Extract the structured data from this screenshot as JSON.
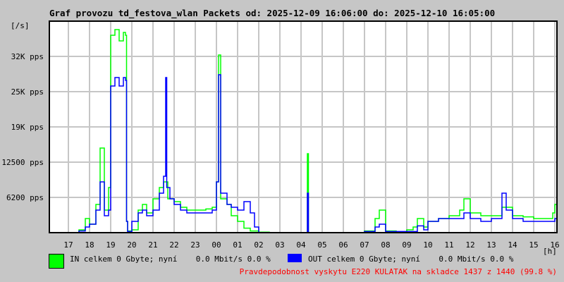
{
  "chart_data": {
    "type": "line",
    "title": "Graf provozu td_festova_wlan Packets od: 2025-12-09 16:06:00 do: 2025-12-10 16:05:00",
    "ylabel": "[/s]",
    "xlabel": "[h]",
    "xlim": [
      16.1,
      40.1
    ],
    "ylim": [
      0,
      37500
    ],
    "grid": true,
    "x_ticks": [
      {
        "x": 17,
        "label": "17"
      },
      {
        "x": 18,
        "label": "18"
      },
      {
        "x": 19,
        "label": "19"
      },
      {
        "x": 20,
        "label": "20"
      },
      {
        "x": 21,
        "label": "21"
      },
      {
        "x": 22,
        "label": "22"
      },
      {
        "x": 23,
        "label": "23"
      },
      {
        "x": 24,
        "label": "00"
      },
      {
        "x": 25,
        "label": "01"
      },
      {
        "x": 26,
        "label": "02"
      },
      {
        "x": 27,
        "label": "03"
      },
      {
        "x": 28,
        "label": "04"
      },
      {
        "x": 29,
        "label": "05"
      },
      {
        "x": 30,
        "label": "06"
      },
      {
        "x": 31,
        "label": "07"
      },
      {
        "x": 32,
        "label": "08"
      },
      {
        "x": 33,
        "label": "09"
      },
      {
        "x": 34,
        "label": "10"
      },
      {
        "x": 35,
        "label": "11"
      },
      {
        "x": 36,
        "label": "12"
      },
      {
        "x": 37,
        "label": "13"
      },
      {
        "x": 38,
        "label": "14"
      },
      {
        "x": 39,
        "label": "15"
      },
      {
        "x": 40,
        "label": "16"
      }
    ],
    "y_ticks": [
      {
        "y": 6250,
        "label": "6200 pps"
      },
      {
        "y": 12500,
        "label": "12500 pps"
      },
      {
        "y": 18750,
        "label": "19K pps"
      },
      {
        "y": 25000,
        "label": "25K pps"
      },
      {
        "y": 31250,
        "label": "32K pps"
      }
    ],
    "series": [
      {
        "name": "IN",
        "color": "#00ff00",
        "points": [
          [
            16.1,
            0
          ],
          [
            16.5,
            0
          ],
          [
            17.0,
            0
          ],
          [
            17.5,
            500
          ],
          [
            17.8,
            2500
          ],
          [
            18.0,
            1500
          ],
          [
            18.3,
            5000
          ],
          [
            18.5,
            15000
          ],
          [
            18.7,
            4000
          ],
          [
            18.9,
            8000
          ],
          [
            19.0,
            35000
          ],
          [
            19.2,
            36000
          ],
          [
            19.4,
            34000
          ],
          [
            19.6,
            35500
          ],
          [
            19.7,
            35000
          ],
          [
            19.75,
            2000
          ],
          [
            19.8,
            300
          ],
          [
            20.0,
            500
          ],
          [
            20.3,
            4000
          ],
          [
            20.5,
            5000
          ],
          [
            20.7,
            3500
          ],
          [
            21.0,
            6000
          ],
          [
            21.3,
            8000
          ],
          [
            21.5,
            9000
          ],
          [
            21.7,
            6000
          ],
          [
            22.0,
            5500
          ],
          [
            22.3,
            4500
          ],
          [
            22.6,
            4000
          ],
          [
            23.0,
            4000
          ],
          [
            23.5,
            4200
          ],
          [
            23.8,
            4500
          ],
          [
            24.0,
            9000
          ],
          [
            24.1,
            31500
          ],
          [
            24.2,
            6000
          ],
          [
            24.5,
            5000
          ],
          [
            24.7,
            3000
          ],
          [
            25.0,
            2000
          ],
          [
            25.3,
            800
          ],
          [
            25.6,
            300
          ],
          [
            26.0,
            100
          ],
          [
            26.5,
            0
          ],
          [
            27.0,
            0
          ],
          [
            27.5,
            0
          ],
          [
            28.0,
            0
          ],
          [
            28.3,
            14000
          ],
          [
            28.35,
            0
          ],
          [
            29.0,
            0
          ],
          [
            30.0,
            0
          ],
          [
            30.5,
            0
          ],
          [
            31.0,
            300
          ],
          [
            31.5,
            2500
          ],
          [
            31.7,
            4000
          ],
          [
            32.0,
            300
          ],
          [
            32.5,
            0
          ],
          [
            33.0,
            500
          ],
          [
            33.3,
            1000
          ],
          [
            33.5,
            2500
          ],
          [
            33.8,
            1000
          ],
          [
            34.0,
            2000
          ],
          [
            34.5,
            2500
          ],
          [
            35.0,
            3000
          ],
          [
            35.5,
            4000
          ],
          [
            35.7,
            6000
          ],
          [
            36.0,
            3500
          ],
          [
            36.5,
            3000
          ],
          [
            37.0,
            3000
          ],
          [
            37.5,
            4500
          ],
          [
            38.0,
            3000
          ],
          [
            38.5,
            2800
          ],
          [
            39.0,
            2500
          ],
          [
            39.5,
            2500
          ],
          [
            39.9,
            3500
          ],
          [
            40.0,
            5000
          ],
          [
            40.1,
            3000
          ]
        ]
      },
      {
        "name": "OUT",
        "color": "#0000ff",
        "points": [
          [
            16.1,
            0
          ],
          [
            17.0,
            0
          ],
          [
            17.5,
            300
          ],
          [
            17.8,
            1000
          ],
          [
            18.0,
            1500
          ],
          [
            18.3,
            4000
          ],
          [
            18.5,
            9000
          ],
          [
            18.7,
            3000
          ],
          [
            18.9,
            4000
          ],
          [
            19.0,
            26000
          ],
          [
            19.2,
            27500
          ],
          [
            19.4,
            26000
          ],
          [
            19.6,
            27500
          ],
          [
            19.7,
            27000
          ],
          [
            19.75,
            2000
          ],
          [
            19.8,
            200
          ],
          [
            20.0,
            2000
          ],
          [
            20.3,
            3500
          ],
          [
            20.5,
            4000
          ],
          [
            20.7,
            3000
          ],
          [
            21.0,
            4000
          ],
          [
            21.3,
            7000
          ],
          [
            21.5,
            10000
          ],
          [
            21.6,
            27500
          ],
          [
            21.65,
            8000
          ],
          [
            21.8,
            6000
          ],
          [
            22.0,
            5000
          ],
          [
            22.3,
            4000
          ],
          [
            22.6,
            3500
          ],
          [
            23.0,
            3500
          ],
          [
            23.5,
            3500
          ],
          [
            23.8,
            4000
          ],
          [
            24.0,
            9000
          ],
          [
            24.1,
            28000
          ],
          [
            24.2,
            7000
          ],
          [
            24.5,
            5000
          ],
          [
            24.7,
            4500
          ],
          [
            25.0,
            4000
          ],
          [
            25.3,
            5500
          ],
          [
            25.6,
            3500
          ],
          [
            25.8,
            1000
          ],
          [
            26.0,
            0
          ],
          [
            27.0,
            0
          ],
          [
            28.0,
            0
          ],
          [
            28.3,
            7000
          ],
          [
            28.35,
            0
          ],
          [
            29.0,
            0
          ],
          [
            30.0,
            0
          ],
          [
            31.0,
            200
          ],
          [
            31.5,
            1000
          ],
          [
            31.7,
            1500
          ],
          [
            32.0,
            200
          ],
          [
            33.0,
            200
          ],
          [
            33.5,
            1200
          ],
          [
            33.8,
            500
          ],
          [
            34.0,
            2000
          ],
          [
            34.5,
            2500
          ],
          [
            35.0,
            2500
          ],
          [
            35.5,
            2500
          ],
          [
            35.7,
            3500
          ],
          [
            36.0,
            2500
          ],
          [
            36.5,
            2000
          ],
          [
            37.0,
            2500
          ],
          [
            37.5,
            7000
          ],
          [
            37.7,
            4000
          ],
          [
            38.0,
            2500
          ],
          [
            38.5,
            2000
          ],
          [
            39.0,
            2000
          ],
          [
            39.5,
            2000
          ],
          [
            40.0,
            2500
          ],
          [
            40.1,
            2000
          ]
        ]
      }
    ],
    "legend": {
      "in_text": "IN celkem 0 Gbyte; nyní    0.0 Mbit/s 0.0 %",
      "out_text": "OUT celkem 0 Gbyte; nyní    0.0 Mbit/s 0.0 %",
      "placement": "bottom"
    },
    "footer_note": "Pravdepodobnost vyskytu E220 KULATAK na skladce 1437 z 1440 (99.8 %)"
  },
  "colors": {
    "in": "#00ff00",
    "out": "#0000ff",
    "grid": "#c6c6c6",
    "note": "#ff0000"
  }
}
